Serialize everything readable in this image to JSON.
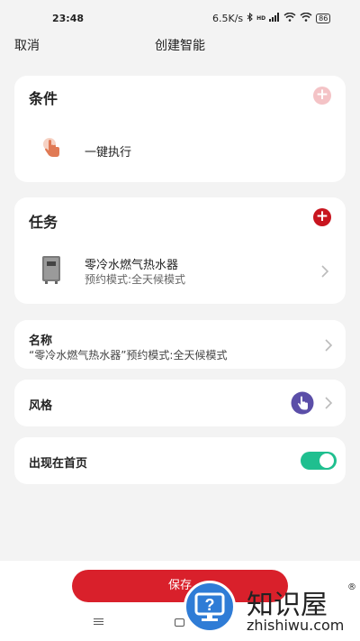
{
  "status_bar": {
    "time": "23:48",
    "speed": "6.5K/s",
    "battery": "86"
  },
  "nav": {
    "cancel": "取消",
    "title": "创建智能"
  },
  "condition": {
    "title": "条件",
    "item_label": "一键执行"
  },
  "task": {
    "title": "任务",
    "device_name": "零冷水燃气热水器",
    "device_mode": "预约模式:全天候模式"
  },
  "name_field": {
    "label": "名称",
    "value": "“零冷水燃气热水器”预约模式:全天候模式"
  },
  "style_row": {
    "label": "风格"
  },
  "home_row": {
    "label": "出现在首页",
    "enabled": true
  },
  "save_button": "保存",
  "watermark": {
    "brand": "知识屋",
    "domain": "zhishiwu.com",
    "reg": "®"
  },
  "colors": {
    "accent_red": "#d9202b",
    "toggle_green": "#1fbf8f",
    "icon_orange": "#e07a55",
    "style_purple": "#5b4ea8",
    "watermark_blue": "#2f7cd6"
  }
}
